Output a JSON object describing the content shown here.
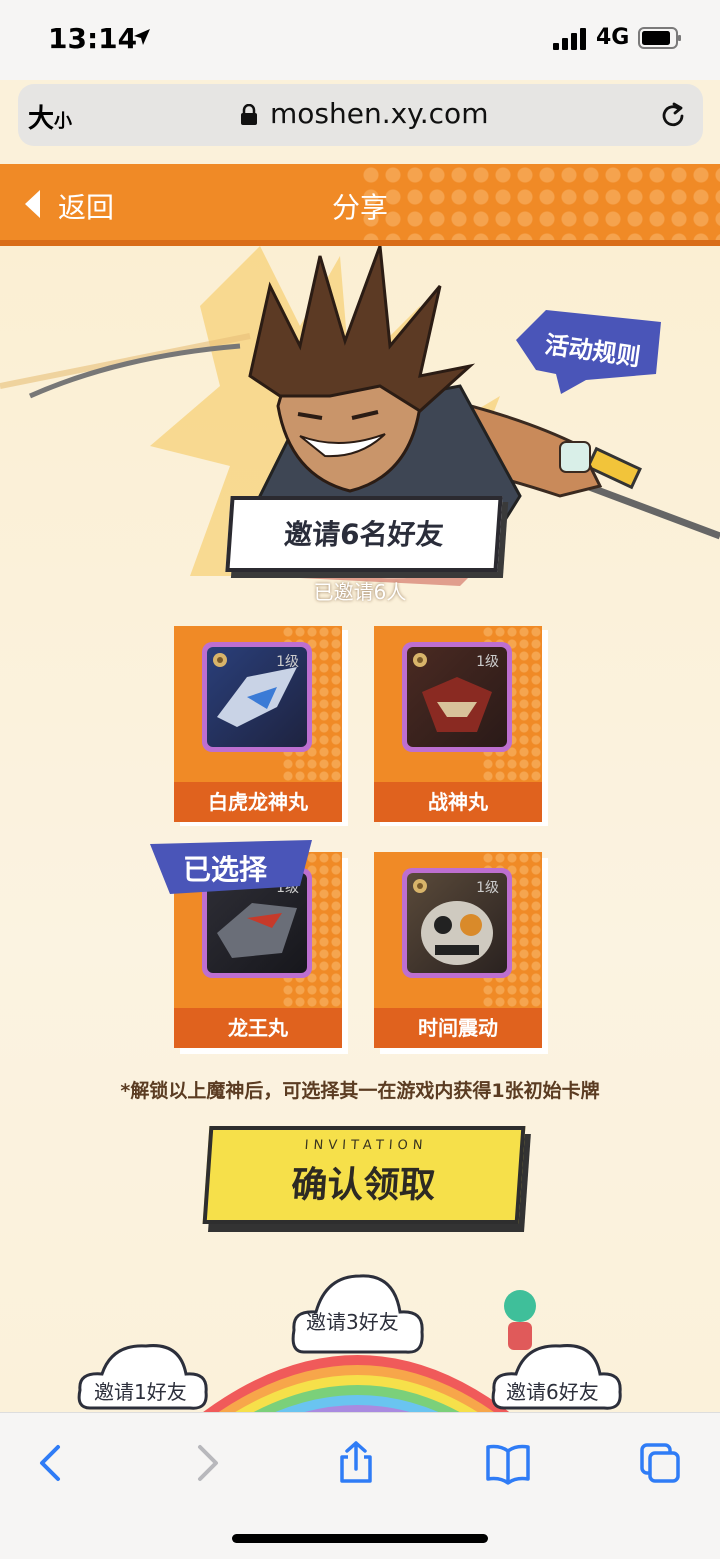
{
  "status_bar": {
    "time": "13:14",
    "network": "4G"
  },
  "address_bar": {
    "text_size_big": "大",
    "text_size_small": "小",
    "url": "moshen.xy.com"
  },
  "header": {
    "back_label": "返回",
    "title": "分享"
  },
  "hero": {
    "rules_label": "活动规则"
  },
  "invite": {
    "title": "邀请6名好友",
    "invited_count_text": "已邀请6人"
  },
  "cards": [
    {
      "name": "白虎龙神丸",
      "level": "1级"
    },
    {
      "name": "战神丸",
      "level": "1级"
    },
    {
      "name": "龙王丸",
      "level": "1级",
      "selected": true
    },
    {
      "name": "时间震动",
      "level": "1级"
    }
  ],
  "selected_badge": "已选择",
  "note": "*解锁以上魔神后，可选择其一在游戏内获得1张初始卡牌",
  "confirm": {
    "sub_label": "INVITATION",
    "label": "确认领取"
  },
  "milestones": [
    {
      "label": "邀请1好友"
    },
    {
      "label": "邀请3好友"
    },
    {
      "label": "邀请6好友"
    }
  ],
  "colors": {
    "header": "#f08a26",
    "card": "#f08a26",
    "card_label": "#e0621e",
    "badge": "#4a55b8",
    "button": "#f6e04a",
    "background": "#fbf1da"
  },
  "toolbar_icons": [
    "back-icon",
    "forward-icon",
    "share-icon",
    "bookmarks-icon",
    "tabs-icon"
  ]
}
